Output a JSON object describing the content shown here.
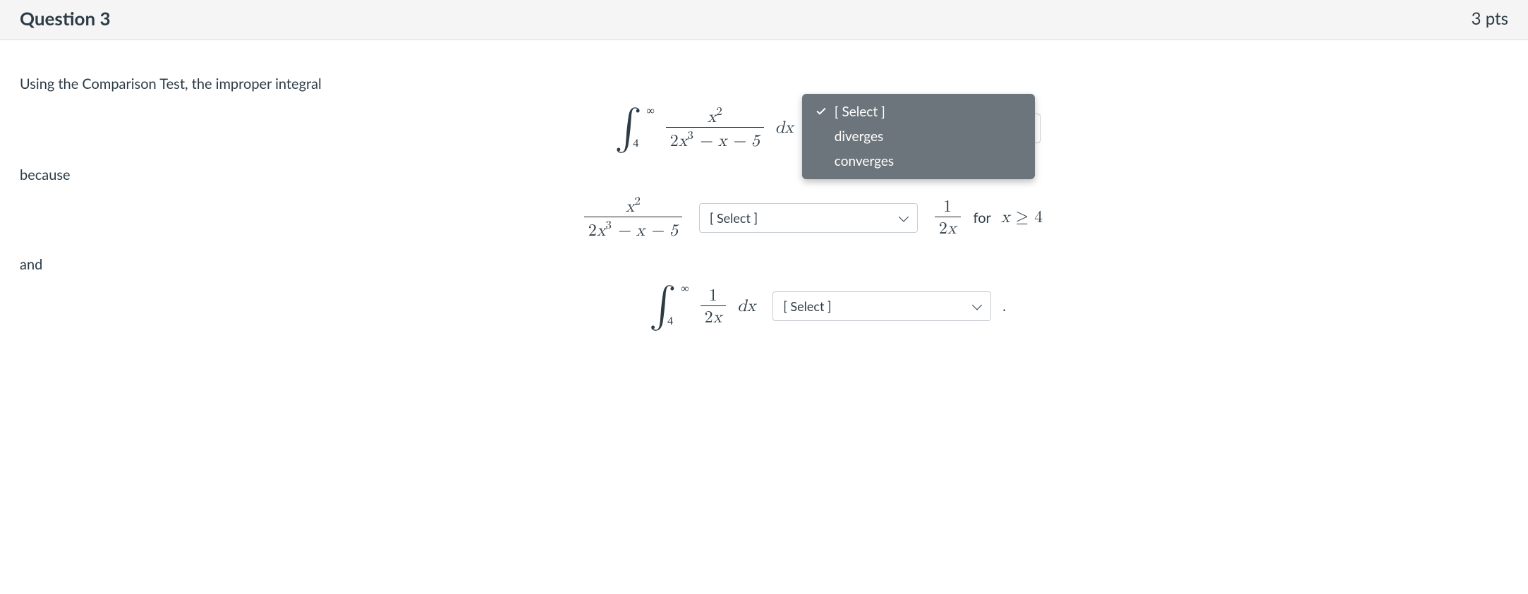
{
  "header": {
    "title": "Question 3",
    "points": "3 pts"
  },
  "body": {
    "prompt": "Using the Comparison Test, the improper integral",
    "integral1": {
      "upper": "∞",
      "lower": "4",
      "frac_num": "x",
      "frac_num_exp": "2",
      "frac_den_a": "2",
      "frac_den_bvar": "x",
      "frac_den_bexp": "3",
      "frac_den_rest": " − x − 5",
      "dx": "dx"
    },
    "dropdown1": {
      "selected_label": "[ Select ]",
      "options": [
        "[ Select ]",
        "diverges",
        "converges"
      ]
    },
    "because": "because",
    "compare": {
      "left_frac_num": "x",
      "left_frac_num_exp": "2",
      "left_den_a": "2",
      "left_den_bvar": "x",
      "left_den_bexp": "3",
      "left_den_rest": " − x − 5",
      "right_frac_num": "1",
      "right_den_a": "2",
      "right_den_var": "x",
      "for_text": " for ",
      "xvar": "x",
      "geq": "≥",
      "four": "4"
    },
    "dropdown2": {
      "selected_label": "[ Select ]"
    },
    "and": "and",
    "integral2": {
      "upper": "∞",
      "lower": "4",
      "frac_num": "1",
      "frac_den_a": "2",
      "frac_den_var": "x",
      "dx": "dx"
    },
    "dropdown3": {
      "selected_label": "[ Select ]"
    },
    "period": "."
  }
}
